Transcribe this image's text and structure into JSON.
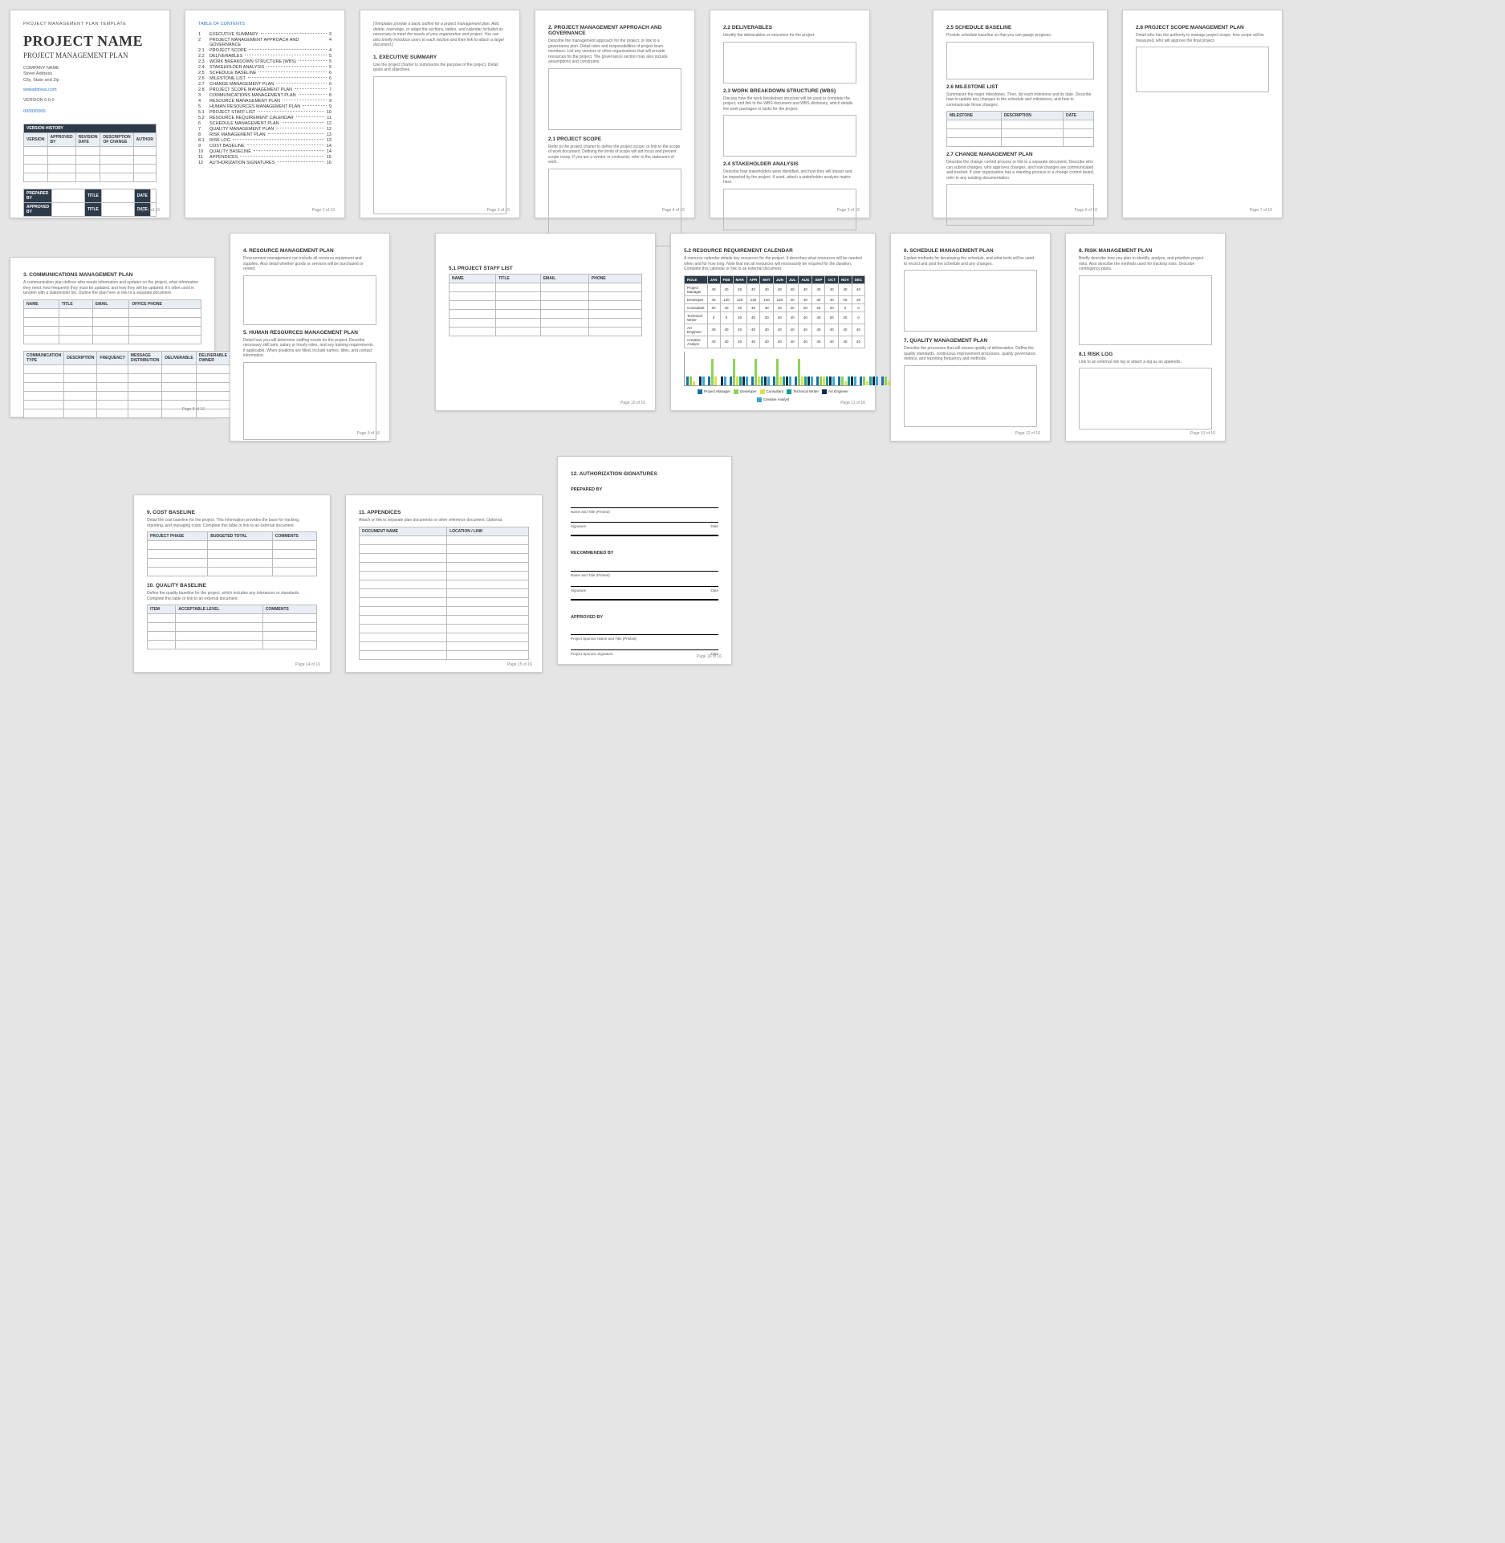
{
  "doc": {
    "template_label": "PROJECT MANAGEMENT PLAN TEMPLATE",
    "title": "PROJECT NAME",
    "subtitle": "PROJECT MANAGEMENT PLAN",
    "company": "COMPANY NAME",
    "addr1": "Street Address",
    "addr2": "City, State and Zip",
    "web": "webaddress.com",
    "version": "VERSION 0.0.0",
    "date": "00/00/0000",
    "vh_title": "VERSION HISTORY",
    "vh_cols": [
      "VERSION",
      "APPROVED BY",
      "REVISION DATE",
      "DESCRIPTION OF CHANGE",
      "AUTHOR"
    ],
    "prep": "PREPARED BY",
    "appr": "APPROVED BY",
    "ttl": "TITLE",
    "dt": "DATE"
  },
  "toc": {
    "title": "TABLE OF CONTENTS",
    "items": [
      {
        "n": "1",
        "t": "EXECUTIVE SUMMARY",
        "p": "3"
      },
      {
        "n": "2",
        "t": "PROJECT MANAGEMENT APPROACH AND GOVERNANCE",
        "p": "4"
      },
      {
        "n": "2.1",
        "t": "PROJECT SCOPE",
        "p": "4"
      },
      {
        "n": "2.2",
        "t": "DELIVERABLES",
        "p": "5"
      },
      {
        "n": "2.3",
        "t": "WORK BREAKDOWN STRUCTURE (WBS)",
        "p": "5"
      },
      {
        "n": "2.4",
        "t": "STAKEHOLDER ANALYSIS",
        "p": "5"
      },
      {
        "n": "2.5",
        "t": "SCHEDULE BASELINE",
        "p": "6"
      },
      {
        "n": "2.6",
        "t": "MILESTONE LIST",
        "p": "6"
      },
      {
        "n": "2.7",
        "t": "CHANGE MANAGEMENT PLAN",
        "p": "6"
      },
      {
        "n": "2.8",
        "t": "PROJECT SCOPE MANAGEMENT PLAN",
        "p": "7"
      },
      {
        "n": "3",
        "t": "COMMUNICATIONS MANAGEMENT PLAN",
        "p": "8"
      },
      {
        "n": "4",
        "t": "RESOURCE MANAGEMENT PLAN",
        "p": "9"
      },
      {
        "n": "5",
        "t": "HUMAN RESOURCES MANAGEMENT PLAN",
        "p": "9"
      },
      {
        "n": "5.1",
        "t": "PROJECT STAFF LIST",
        "p": "10"
      },
      {
        "n": "5.2",
        "t": "RESOURCE REQUIREMENT CALENDAR",
        "p": "11"
      },
      {
        "n": "6",
        "t": "SCHEDULE MANAGEMENT PLAN",
        "p": "12"
      },
      {
        "n": "7",
        "t": "QUALITY MANAGEMENT PLAN",
        "p": "12"
      },
      {
        "n": "8",
        "t": "RISK MANAGEMENT PLAN",
        "p": "13"
      },
      {
        "n": "8.1",
        "t": "RISK LOG",
        "p": "13"
      },
      {
        "n": "9",
        "t": "COST BASELINE",
        "p": "14"
      },
      {
        "n": "10",
        "t": "QUALITY BASELINE",
        "p": "14"
      },
      {
        "n": "11",
        "t": "APPENDICES",
        "p": "15"
      },
      {
        "n": "12",
        "t": "AUTHORIZATION SIGNATURES",
        "p": "16"
      }
    ]
  },
  "p3": {
    "intro": "[Templates provide a basic outline for a project management plan. Add, delete, rearrange, or adapt the sections, tables, and calendar included as necessary to meet the needs of your organization and project. You can also briefly introduce users to each section and then link to attach a larger document.]",
    "h": "1.  EXECUTIVE SUMMARY",
    "d": "Use the project charter to summarize the purpose of the project. Detail goals and objectives."
  },
  "p4": {
    "h": "2.  PROJECT MANAGEMENT APPROACH AND GOVERNANCE",
    "d": "Describe the management approach for the project, or link to a governance plan. Detail roles and responsibilities of project team members. List any vendors or other organizations that will provide resources for the project. The governance section may also include assumptions and constraints.",
    "h2": "2.1    PROJECT SCOPE",
    "d2": "Refer to the project charter to define the project scope, or link to the scope of work document. Defining the limits of scope will aid focus and prevent scope creep. If you are a vendor or contractor, refer to the statement of work."
  },
  "p5": {
    "h1": "2.2    DELIVERABLES",
    "d1": "Identify the deliverables or outcomes for the project.",
    "h2": "2.3    WORK BREAKDOWN STRUCTURE (WBS)",
    "d2": "Discuss how the work breakdown structure will be used to complete the project, and link to the WBS document and WBS dictionary, which details the work packages or tasks for the project.",
    "h3": "2.4    STAKEHOLDER ANALYSIS",
    "d3": "Describe how stakeholders were identified, and how they will impact and be impacted by the project. If used, attach a stakeholder analysis matrix here."
  },
  "p6": {
    "h1": "2.5    SCHEDULE BASELINE",
    "d1": "Provide schedule baseline so that you can gauge progress.",
    "h2": "2.6    MILESTONE LIST",
    "d2": "Summarize the major milestones. Then, list each milestone and its date. Describe how to update any changes to the schedule and milestones, and how to communicate those changes.",
    "cols": [
      "MILESTONE",
      "DESCRIPTION",
      "DATE"
    ],
    "h3": "2.7    CHANGE MANAGEMENT PLAN",
    "d3": "Describe the change control process or link to a separate document. Describe who can submit changes, who approves changes, and how changes are communicated and tracked. If your organization has a standing process or a change control board, refer to any existing documentation."
  },
  "p7": {
    "h": "2.8    PROJECT SCOPE MANAGEMENT PLAN",
    "d": "Detail who has the authority to manage project scope, how scope will be measured, who will approve the final project."
  },
  "p8": {
    "h": "3.  COMMUNICATIONS MANAGEMENT PLAN",
    "d": "A communication plan defines who needs information and updates on the project, what information they need, how frequently they must be updated, and how they will be updated. It's often used in tandem with a stakeholder list. Outline the plan here or link to a separate document.",
    "t1": [
      "NAME",
      "TITLE",
      "EMAIL",
      "OFFICE PHONE"
    ],
    "t2": [
      "COMMUNICATION TYPE",
      "DESCRIPTION",
      "FREQUENCY",
      "MESSAGE DISTRIBUTION",
      "DELIVERABLE",
      "DELIVERABLE OWNER"
    ]
  },
  "p9": {
    "h1": "4.  RESOURCE MANAGEMENT PLAN",
    "d1": "Procurement management can include all resource equipment and supplies. Also detail whether goods or services will be purchased or rented.",
    "h2": "5.  HUMAN RESOURCES MANAGEMENT PLAN",
    "d2": "Detail how you will determine staffing needs for the project. Describe necessary skill sets, salary or hourly rates, and any training requirements, if applicable. When positions are filled, include names, titles, and contact information."
  },
  "p10": {
    "h": "5.1    PROJECT STAFF LIST",
    "cols": [
      "NAME",
      "TITLE",
      "EMAIL",
      "PHONE"
    ]
  },
  "p11": {
    "h": "5.2    RESOURCE REQUIREMENT CALENDAR",
    "d": "A resource calendar details key resources for the project. It describes what resources will be needed when and for how long. Note that not all resources will necessarily be required for the duration. Complete this calendar or link to an external document."
  },
  "p12": {
    "h1": "6.  SCHEDULE MANAGEMENT PLAN",
    "d1": "Explain methods for developing the schedule, and what tools will be used to record and post the schedule and any changes.",
    "h2": "7.  QUALITY MANAGEMENT PLAN",
    "d2": "Describe the processes that will ensure quality of deliverables. Define the quality standards, continuous improvement processes, quality governance, metrics, and reporting frequency and methods."
  },
  "p13": {
    "h1": "8.  RISK MANAGEMENT PLAN",
    "d1": "Briefly describe how you plan to identify, analyze, and prioritize project risks. Also describe the methods used for tracking risks. Describe contingency plans.",
    "h2": "8.1    RISK LOG",
    "d2": "Link to an external risk log or attach a log as an appendix."
  },
  "p14": {
    "h1": "9.  COST BASELINE",
    "d1": "Detail the cost baseline for the project. This information provides the base for tracking, reporting, and managing costs. Complete this table or link to an external document.",
    "c1": [
      "PROJECT PHASE",
      "BUDGETED TOTAL",
      "COMMENTS"
    ],
    "h2": "10.  QUALITY BASELINE",
    "d2": "Define the quality baseline for the project, which includes any tolerances or standards. Complete this table or link to an external document.",
    "c2": [
      "ITEM",
      "ACCEPTABLE LEVEL",
      "COMMENTS"
    ]
  },
  "p15": {
    "h": "11.  APPENDICES",
    "d": "Attach or link to separate plan documents or other reference document. Optional.",
    "cols": [
      "DOCUMENT NAME",
      "LOCATION / LINK"
    ]
  },
  "p16": {
    "h": "12.  AUTHORIZATION SIGNATURES",
    "a": "PREPARED BY",
    "b": "RECOMMENDED BY",
    "c": "APPROVED BY",
    "n1": "Name and Title  (Printed)",
    "n2": "Name and Title (Printed)",
    "n3": "Project Sponsor Name and Title  (Printed)",
    "sig": "Signature",
    "sig3": "Project Sponsor Signature",
    "date": "Date"
  },
  "footers": [
    "Page 1 of 16",
    "Page 2 of 16",
    "Page 3 of 16",
    "Page 4 of 16",
    "Page 5 of 16",
    "Page 6 of 16",
    "Page 7 of 16",
    "Page 8 of 16",
    "Page 9 of 16",
    "Page 10 of 16",
    "Page 11 of 16",
    "Page 12 of 16",
    "Page 13 of 16",
    "Page 14 of 16",
    "Page 15 of 16",
    "Page 16 of 16"
  ],
  "chart_data": {
    "type": "table+bar",
    "months": [
      "JAN",
      "FEB",
      "MAR",
      "APR",
      "MAY",
      "JUN",
      "JUL",
      "AUG",
      "SEP",
      "OCT",
      "NOV",
      "DEC"
    ],
    "roles": [
      "Project Manager",
      "Developer",
      "Consultant",
      "Technical Writer",
      "Art Engineer",
      "Creative Analyst"
    ],
    "colors": [
      "#1d6fa5",
      "#8fd15a",
      "#d9e24b",
      "#169e8c",
      "#0b2e4f",
      "#3aa7d1"
    ],
    "table": [
      [
        40,
        40,
        40,
        40,
        40,
        40,
        40,
        40,
        40,
        40,
        40,
        40
      ],
      [
        40,
        120,
        120,
        120,
        120,
        120,
        40,
        40,
        40,
        40,
        20,
        20
      ],
      [
        20,
        40,
        40,
        40,
        40,
        40,
        40,
        20,
        20,
        20,
        0,
        0
      ],
      [
        0,
        0,
        40,
        40,
        40,
        40,
        40,
        40,
        40,
        20,
        20,
        0
      ],
      [
        40,
        40,
        40,
        40,
        40,
        40,
        40,
        40,
        40,
        40,
        40,
        40
      ],
      [
        40,
        40,
        40,
        40,
        40,
        40,
        40,
        40,
        40,
        40,
        40,
        40
      ]
    ],
    "ylim": [
      0,
      350
    ]
  }
}
